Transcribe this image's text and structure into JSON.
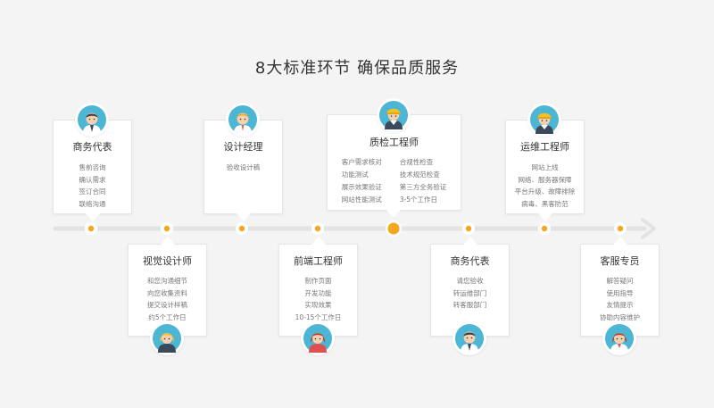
{
  "title": "8大标准环节 确保品质服务",
  "colors": {
    "accent": "#f5a81e",
    "line": "#e3e3e3",
    "avatar_bg": "#4db6d4"
  },
  "top_roles": [
    {
      "title": "商务代表",
      "items": [
        "售前咨询",
        "确认需求",
        "签订合同",
        "联络沟通"
      ],
      "icon": "male-business-rep-avatar-icon"
    },
    {
      "title": "设计经理",
      "items": [
        "验收设计稿"
      ],
      "icon": "male-design-manager-avatar-icon"
    },
    {
      "title": "质检工程师",
      "col1": [
        "客户需求核对",
        "功能测试",
        "展示效果验证",
        "网站性能测试"
      ],
      "col2": [
        "合规性检查",
        "技术规范检查",
        "第三方全务验证",
        "3-5个工作日"
      ],
      "icon": "engineer-hardhat-avatar-icon"
    },
    {
      "title": "运维工程师",
      "items": [
        "网站上线",
        "网络、服务器保障",
        "平台升级、故障排除",
        "病毒、黑客防范"
      ],
      "icon": "engineer-hardhat-avatar-icon"
    }
  ],
  "bottom_roles": [
    {
      "title": "视觉设计师",
      "items": [
        "和您沟通细节",
        "向您收集资料",
        "提交设计样稿",
        "约5个工作日"
      ],
      "icon": "female-designer-avatar-icon"
    },
    {
      "title": "前端工程师",
      "items": [
        "制作页面",
        "开发功能",
        "实现效果",
        "10-15个工作日"
      ],
      "icon": "female-frontend-avatar-icon"
    },
    {
      "title": "商务代表",
      "items": [
        "请您验收",
        "转运维部门",
        "转客服部门"
      ],
      "icon": "male-business-rep-avatar-icon"
    },
    {
      "title": "客服专员",
      "items": [
        "解答疑问",
        "使用指导",
        "友情提示",
        "协助内容维护"
      ],
      "icon": "female-support-avatar-icon"
    }
  ]
}
